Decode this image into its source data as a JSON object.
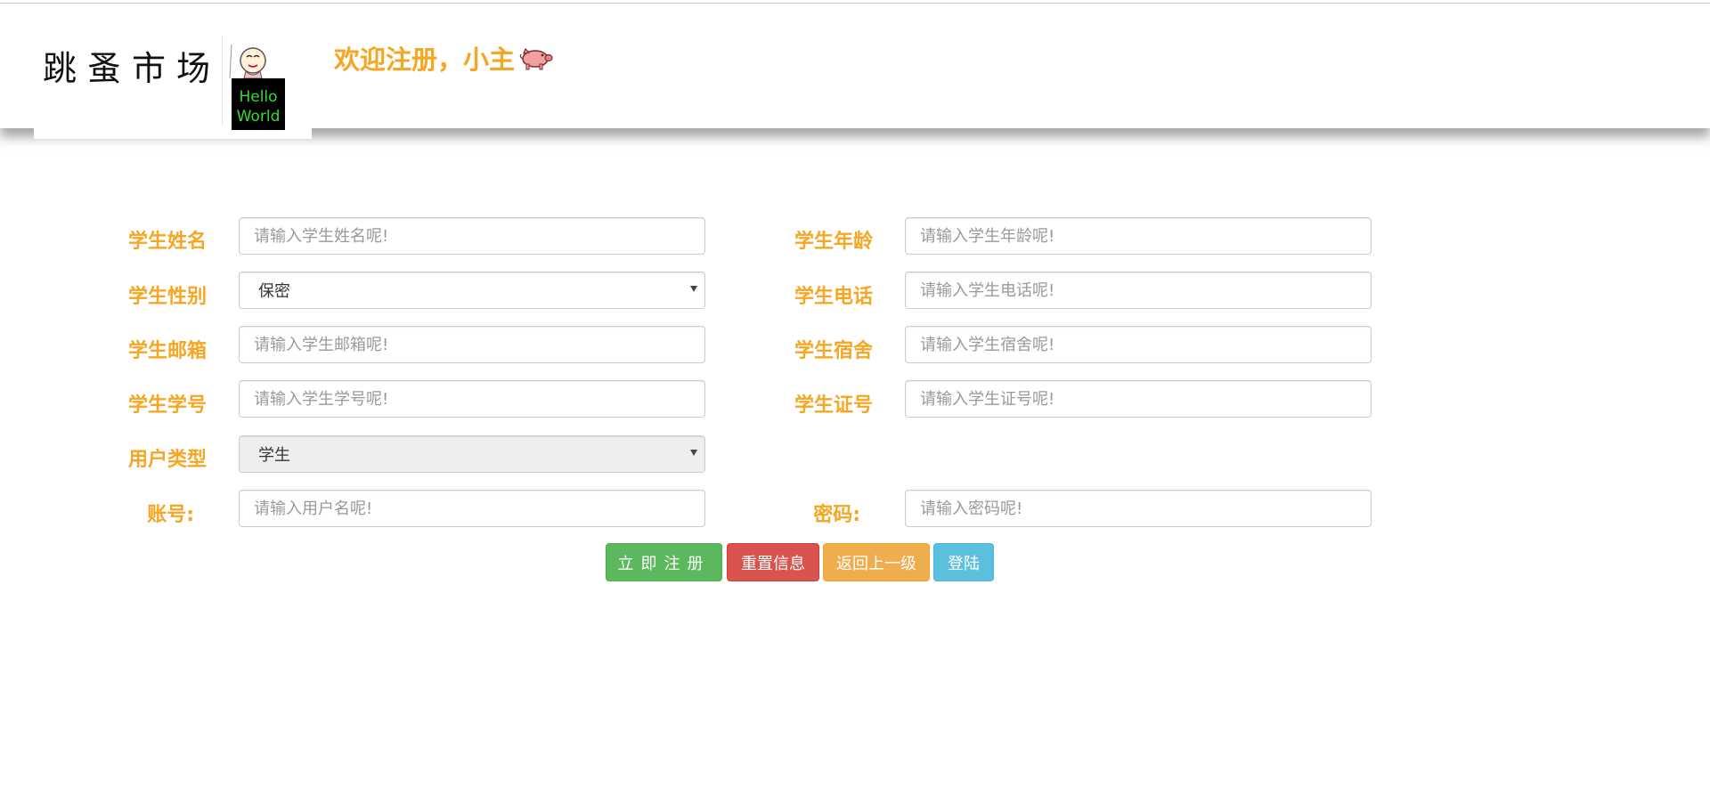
{
  "header": {
    "brand": "跳蚤市场",
    "logo_text": [
      "Hello",
      "World"
    ],
    "welcome": "欢迎注册，小主"
  },
  "form": {
    "left": [
      {
        "label": "学生姓名",
        "type": "input",
        "placeholder": "请输入学生姓名呢!"
      },
      {
        "label": "学生性别",
        "type": "select",
        "value": "保密"
      },
      {
        "label": "学生邮箱",
        "type": "input",
        "placeholder": "请输入学生邮箱呢!"
      },
      {
        "label": "学生学号",
        "type": "input",
        "placeholder": "请输入学生学号呢!"
      },
      {
        "label": "用户类型",
        "type": "select",
        "value": "学生",
        "disabled": true
      },
      {
        "label": "账号:",
        "type": "input",
        "placeholder": "请输入用户名呢!"
      }
    ],
    "right": [
      {
        "label": "学生年龄",
        "type": "input",
        "placeholder": "请输入学生年龄呢!"
      },
      {
        "label": "学生电话",
        "type": "input",
        "placeholder": "请输入学生电话呢!"
      },
      {
        "label": "学生宿舍",
        "type": "input",
        "placeholder": "请输入学生宿舍呢!"
      },
      {
        "label": "学生证号",
        "type": "input",
        "placeholder": "请输入学生证号呢!"
      },
      {
        "label": "密码:",
        "type": "input",
        "placeholder": "请输入密码呢!"
      }
    ]
  },
  "buttons": {
    "register": "立即注册",
    "reset": "重置信息",
    "back": "返回上一级",
    "login": "登陆"
  },
  "colors": {
    "accent": "#f5a623",
    "success": "#5cb85c",
    "danger": "#d9534f",
    "warning": "#f0ad4e",
    "info": "#5bc0de"
  }
}
